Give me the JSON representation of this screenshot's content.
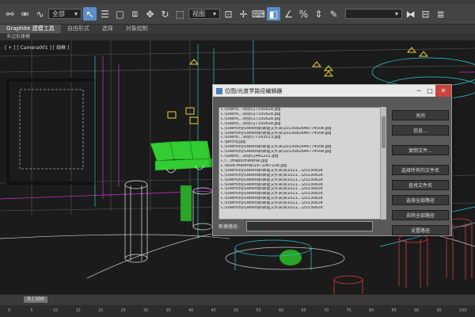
{
  "menu": [
    "",
    "",
    "",
    "",
    "",
    "",
    "",
    "",
    "",
    ""
  ],
  "toolbar": {
    "selection_filter": "全部",
    "view_dropdown": "视图",
    "icons": [
      "link-icon",
      "unlink-icon",
      "bind-space-warp-icon",
      "selection-filter",
      "select-object-icon",
      "select-by-name-icon",
      "rect-region-icon",
      "window-crossing-icon",
      "move-icon",
      "rotate-icon",
      "scale-icon",
      "ref-coord-icon",
      "pivot-icon",
      "select-manipulate-icon",
      "keyboard-shortcut-icon",
      "snaps-toggle-icon",
      "angle-snap-icon",
      "percent-snap-icon",
      "spinner-snap-icon",
      "named-selection",
      "mirror-icon",
      "align-icon"
    ]
  },
  "ribbon": {
    "tabs": [
      "Graphite 建模工具",
      "自由形式",
      "选择",
      "对象绘制"
    ],
    "sub_label": "多边形建模"
  },
  "viewport": {
    "label": "[ + ] [ Camera001 ] [ 线框 ]"
  },
  "dialog": {
    "title": "位图/光度学路径编辑器",
    "list_items": [
      "C:\\Users\\...\\材质\\17330628.jpg",
      "C:\\Users\\...\\材质\\17330628.jpg",
      "C:\\Users\\...\\材质\\17330628.jpg",
      "C:\\Users\\...\\材质\\17330628.jpg",
      "C:\\Users\\hy\\Desktop\\新建文件夹\\201308264677450e.jpg",
      "C:\\Users\\hy\\Desktop\\新建文件夹\\201308264677450e.jpg",
      "C:\\Users\\...\\材质\\77163513.jpg",
      "C:\\pitchy.jpg",
      "C:\\Users\\hy\\Desktop\\新建文件夹\\201308264677450e.jpg",
      "C:\\Users\\hy\\Desktop\\新建文件夹\\201308264677450e.jpg",
      "C:\\Users\\...\\材质\\1441201.jpg",
      "C:\\...\\maps\\material.jpg",
      "C:\\blue-material\\1671067108.jpg",
      "C:\\Users\\hy\\Desktop\\新建文件夹\\a\\1021...\\20130828",
      "C:\\Users\\hy\\Desktop\\新建文件夹\\a\\1021...\\20130828",
      "C:\\Users\\hy\\Desktop\\新建文件夹\\a\\1021...\\20130828",
      "C:\\Users\\hy\\Desktop\\新建文件夹\\a\\1021...\\20130828",
      "C:\\Users\\hy\\Desktop\\新建文件夹\\a\\1021...\\20130828",
      "C:\\Users\\hy\\Desktop\\新建文件夹\\a\\1021...\\20130828",
      "C:\\Users\\hy\\Desktop\\新建文件夹\\a\\1021...\\20130828",
      "C:\\Users\\hy\\Desktop\\新建文件夹\\a\\1021...\\20130828",
      "C:\\Users\\hy\\Desktop\\新建文件夹\\a\\1021...\\20130828"
    ],
    "buttons": [
      "关闭",
      "信息...",
      "复制文件...",
      "选择所有的文件名",
      "查找文件名",
      "选择全部路径",
      "去除全部路径",
      "设置路径"
    ],
    "path_label": "新建路径:",
    "controls": {
      "minimize": "─",
      "maximize": "□",
      "close": "✕"
    }
  },
  "timeline": {
    "slider": "0 / 100",
    "ticks": [
      "0",
      "5",
      "10",
      "15",
      "20",
      "25",
      "30",
      "35",
      "40",
      "45",
      "50",
      "55",
      "60",
      "65",
      "70",
      "75",
      "80",
      "85",
      "90",
      "95",
      "100"
    ]
  }
}
